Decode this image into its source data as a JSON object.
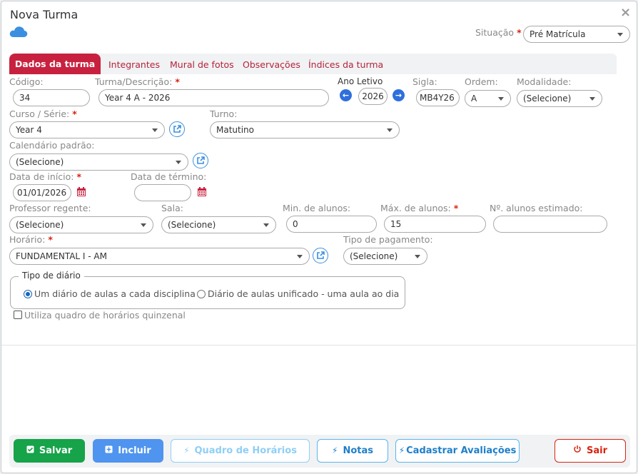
{
  "dialog": {
    "title": "Nova Turma",
    "close": "×"
  },
  "situacao": {
    "label": "Situação",
    "value": "Pré Matrícula"
  },
  "tabs": [
    {
      "label": "Dados da turma"
    },
    {
      "label": "Integrantes"
    },
    {
      "label": "Mural de fotos"
    },
    {
      "label": "Observações"
    },
    {
      "label": "Índices da turma"
    }
  ],
  "form": {
    "codigo": {
      "label": "Código:",
      "value": "34"
    },
    "turma": {
      "label": "Turma/Descrição:",
      "value": "Year 4 A - 2026"
    },
    "ano_letivo": {
      "label": "Ano Letivo",
      "value": "2026"
    },
    "sigla": {
      "label": "Sigla:",
      "value": "MB4Y26"
    },
    "ordem": {
      "label": "Ordem:",
      "value": "A"
    },
    "modalidade": {
      "label": "Modalidade:",
      "value": "(Selecione)"
    },
    "curso": {
      "label": "Curso / Série:",
      "value": "Year 4"
    },
    "turno": {
      "label": "Turno:",
      "value": "Matutino"
    },
    "calendario": {
      "label": "Calendário padrão:",
      "value": "(Selecione)"
    },
    "data_inicio": {
      "label": "Data de início:",
      "value": "01/01/2026"
    },
    "data_termino": {
      "label": "Data de término:",
      "value": ""
    },
    "professor": {
      "label": "Professor regente:",
      "value": "(Selecione)"
    },
    "sala": {
      "label": "Sala:",
      "value": "(Selecione)"
    },
    "min_alunos": {
      "label": "Min. de alunos:",
      "value": "0"
    },
    "max_alunos": {
      "label": "Máx. de alunos:",
      "value": "15"
    },
    "n_alunos_estimado": {
      "label": "Nº. alunos estimado:",
      "value": ""
    },
    "horario": {
      "label": "Horário:",
      "value": "FUNDAMENTAL I - AM"
    },
    "tipo_pagamento": {
      "label": "Tipo de pagamento:",
      "value": "(Selecione)"
    },
    "tipo_diario": {
      "legend": "Tipo de diário",
      "options": [
        "Um diário de aulas a cada disciplina",
        "Diário de aulas unificado - uma aula ao dia"
      ],
      "selected": 0
    },
    "quinzenal": {
      "label": "Utiliza quadro de horários quinzenal",
      "checked": false
    }
  },
  "footer": {
    "salvar": "Salvar",
    "incluir": "Incluir",
    "quadro": "Quadro de Horários",
    "notas": "Notas",
    "cadastrar": "Cadastrar Avaliações",
    "sair": "Sair"
  },
  "colors": {
    "accent": "#c8213f",
    "success": "#16a34a",
    "primary": "#4f94ef",
    "info": "#58b7f0",
    "danger": "#d9230f"
  }
}
